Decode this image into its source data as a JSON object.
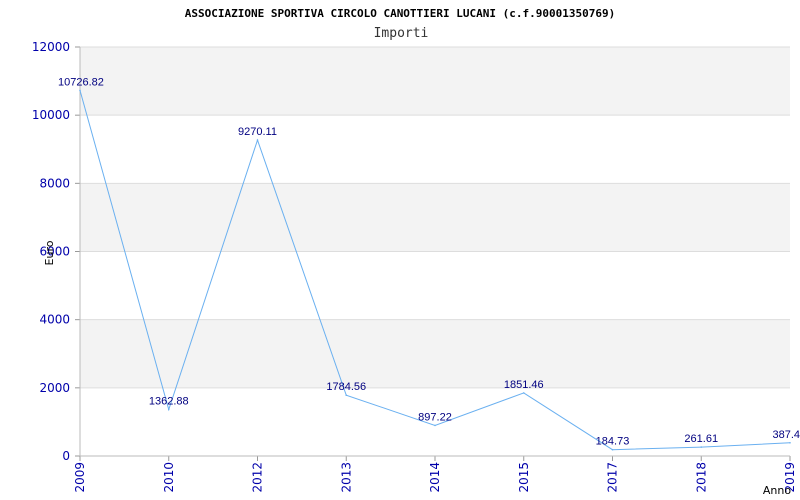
{
  "chart_data": {
    "type": "line",
    "title": "ASSOCIAZIONE SPORTIVA CIRCOLO CANOTTIERI LUCANI (c.f.90001350769)",
    "subtitle": "Importi",
    "xlabel": "Anno",
    "ylabel": "Euro",
    "ylim": [
      0,
      12000
    ],
    "yticks": [
      "0",
      "2000",
      "4000",
      "6000",
      "8000",
      "10000",
      "12000"
    ],
    "x": [
      "2009",
      "2010",
      "2012",
      "2013",
      "2014",
      "2015",
      "2017",
      "2018",
      "2019"
    ],
    "values": [
      10726.82,
      1362.88,
      9270.11,
      1784.56,
      897.22,
      1851.46,
      184.73,
      261.61,
      387.4
    ],
    "data_labels": [
      "10726.82",
      "1362.88",
      "9270.11",
      "1784.56",
      "897.22",
      "1851.46",
      "184.73",
      "261.61",
      "387.4"
    ],
    "grid": true,
    "colors": {
      "line": "#6ab0f0",
      "band": "#f3f3f3",
      "grid": "#dddddd",
      "tick_text": "#0000aa",
      "label_text": "#000080"
    }
  }
}
